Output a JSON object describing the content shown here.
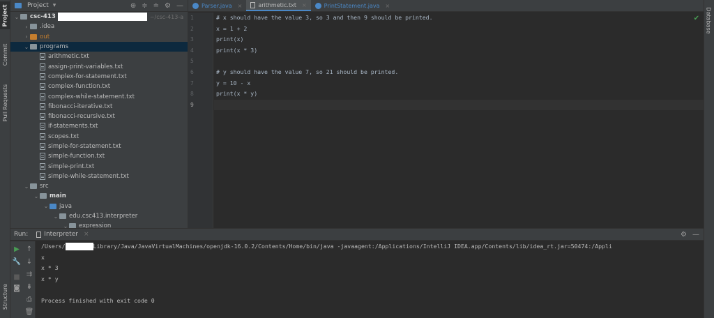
{
  "left_strip": {
    "tabs": [
      "Project",
      "Commit",
      "Pull Requests",
      "Structure"
    ]
  },
  "right_strip": {
    "tabs": [
      "Database"
    ]
  },
  "project_panel": {
    "title": "Project",
    "tree": [
      {
        "label": "csc-413",
        "suffix": "~/csc-413-a",
        "depth": 0,
        "arrow": "open",
        "icon": "folder",
        "bold": true,
        "redact": true
      },
      {
        "label": ".idea",
        "depth": 1,
        "arrow": "closed",
        "icon": "folder"
      },
      {
        "label": "out",
        "depth": 1,
        "arrow": "closed",
        "icon": "folder-orange",
        "orange": true
      },
      {
        "label": "programs",
        "depth": 1,
        "arrow": "open",
        "icon": "folder",
        "selected": true
      },
      {
        "label": "arithmetic.txt",
        "depth": 2,
        "icon": "file"
      },
      {
        "label": "assign-print-variables.txt",
        "depth": 2,
        "icon": "file"
      },
      {
        "label": "complex-for-statement.txt",
        "depth": 2,
        "icon": "file"
      },
      {
        "label": "complex-function.txt",
        "depth": 2,
        "icon": "file"
      },
      {
        "label": "complex-while-statement.txt",
        "depth": 2,
        "icon": "file"
      },
      {
        "label": "fibonacci-iterative.txt",
        "depth": 2,
        "icon": "file"
      },
      {
        "label": "fibonacci-recursive.txt",
        "depth": 2,
        "icon": "file"
      },
      {
        "label": "if-statements.txt",
        "depth": 2,
        "icon": "file"
      },
      {
        "label": "scopes.txt",
        "depth": 2,
        "icon": "file"
      },
      {
        "label": "simple-for-statement.txt",
        "depth": 2,
        "icon": "file"
      },
      {
        "label": "simple-function.txt",
        "depth": 2,
        "icon": "file"
      },
      {
        "label": "simple-print.txt",
        "depth": 2,
        "icon": "file"
      },
      {
        "label": "simple-while-statement.txt",
        "depth": 2,
        "icon": "file"
      },
      {
        "label": "src",
        "depth": 1,
        "arrow": "open",
        "icon": "folder"
      },
      {
        "label": "main",
        "depth": 2,
        "arrow": "open",
        "icon": "folder",
        "bold": true
      },
      {
        "label": "java",
        "depth": 3,
        "arrow": "open",
        "icon": "folder-blue"
      },
      {
        "label": "edu.csc413.interpreter",
        "depth": 4,
        "arrow": "open",
        "icon": "folder"
      },
      {
        "label": "expression",
        "depth": 5,
        "arrow": "open",
        "icon": "folder"
      }
    ]
  },
  "editor": {
    "tabs": [
      {
        "label": "Parser.java",
        "icon": "java",
        "active": false
      },
      {
        "label": "arithmetic.txt",
        "icon": "text",
        "active": true
      },
      {
        "label": "PrintStatement.java",
        "icon": "java",
        "active": false
      }
    ],
    "lines": [
      "# x should have the value 3, so 3 and then 9 should be printed.",
      "x = 1 + 2",
      "print(x)",
      "print(x * 3)",
      "",
      "# y should have the value 7, so 21 should be printed.",
      "y = 10 - x",
      "print(x * y)",
      ""
    ],
    "line_numbers": [
      "1",
      "2",
      "3",
      "4",
      "5",
      "6",
      "7",
      "8",
      "9"
    ],
    "current_line": 9
  },
  "run": {
    "label": "Run:",
    "config": "Interpreter",
    "console": [
      {
        "text": "/Users/",
        "redact": true,
        "after": "Library/Java/JavaVirtualMachines/openjdk-16.0.2/Contents/Home/bin/java -javaagent:/Applications/IntelliJ IDEA.app/Contents/lib/idea_rt.jar=50474:/Appli"
      },
      {
        "text": "x"
      },
      {
        "text": "x * 3"
      },
      {
        "text": "x * y"
      },
      {
        "text": ""
      },
      {
        "text": "Process finished with exit code 0"
      }
    ]
  }
}
